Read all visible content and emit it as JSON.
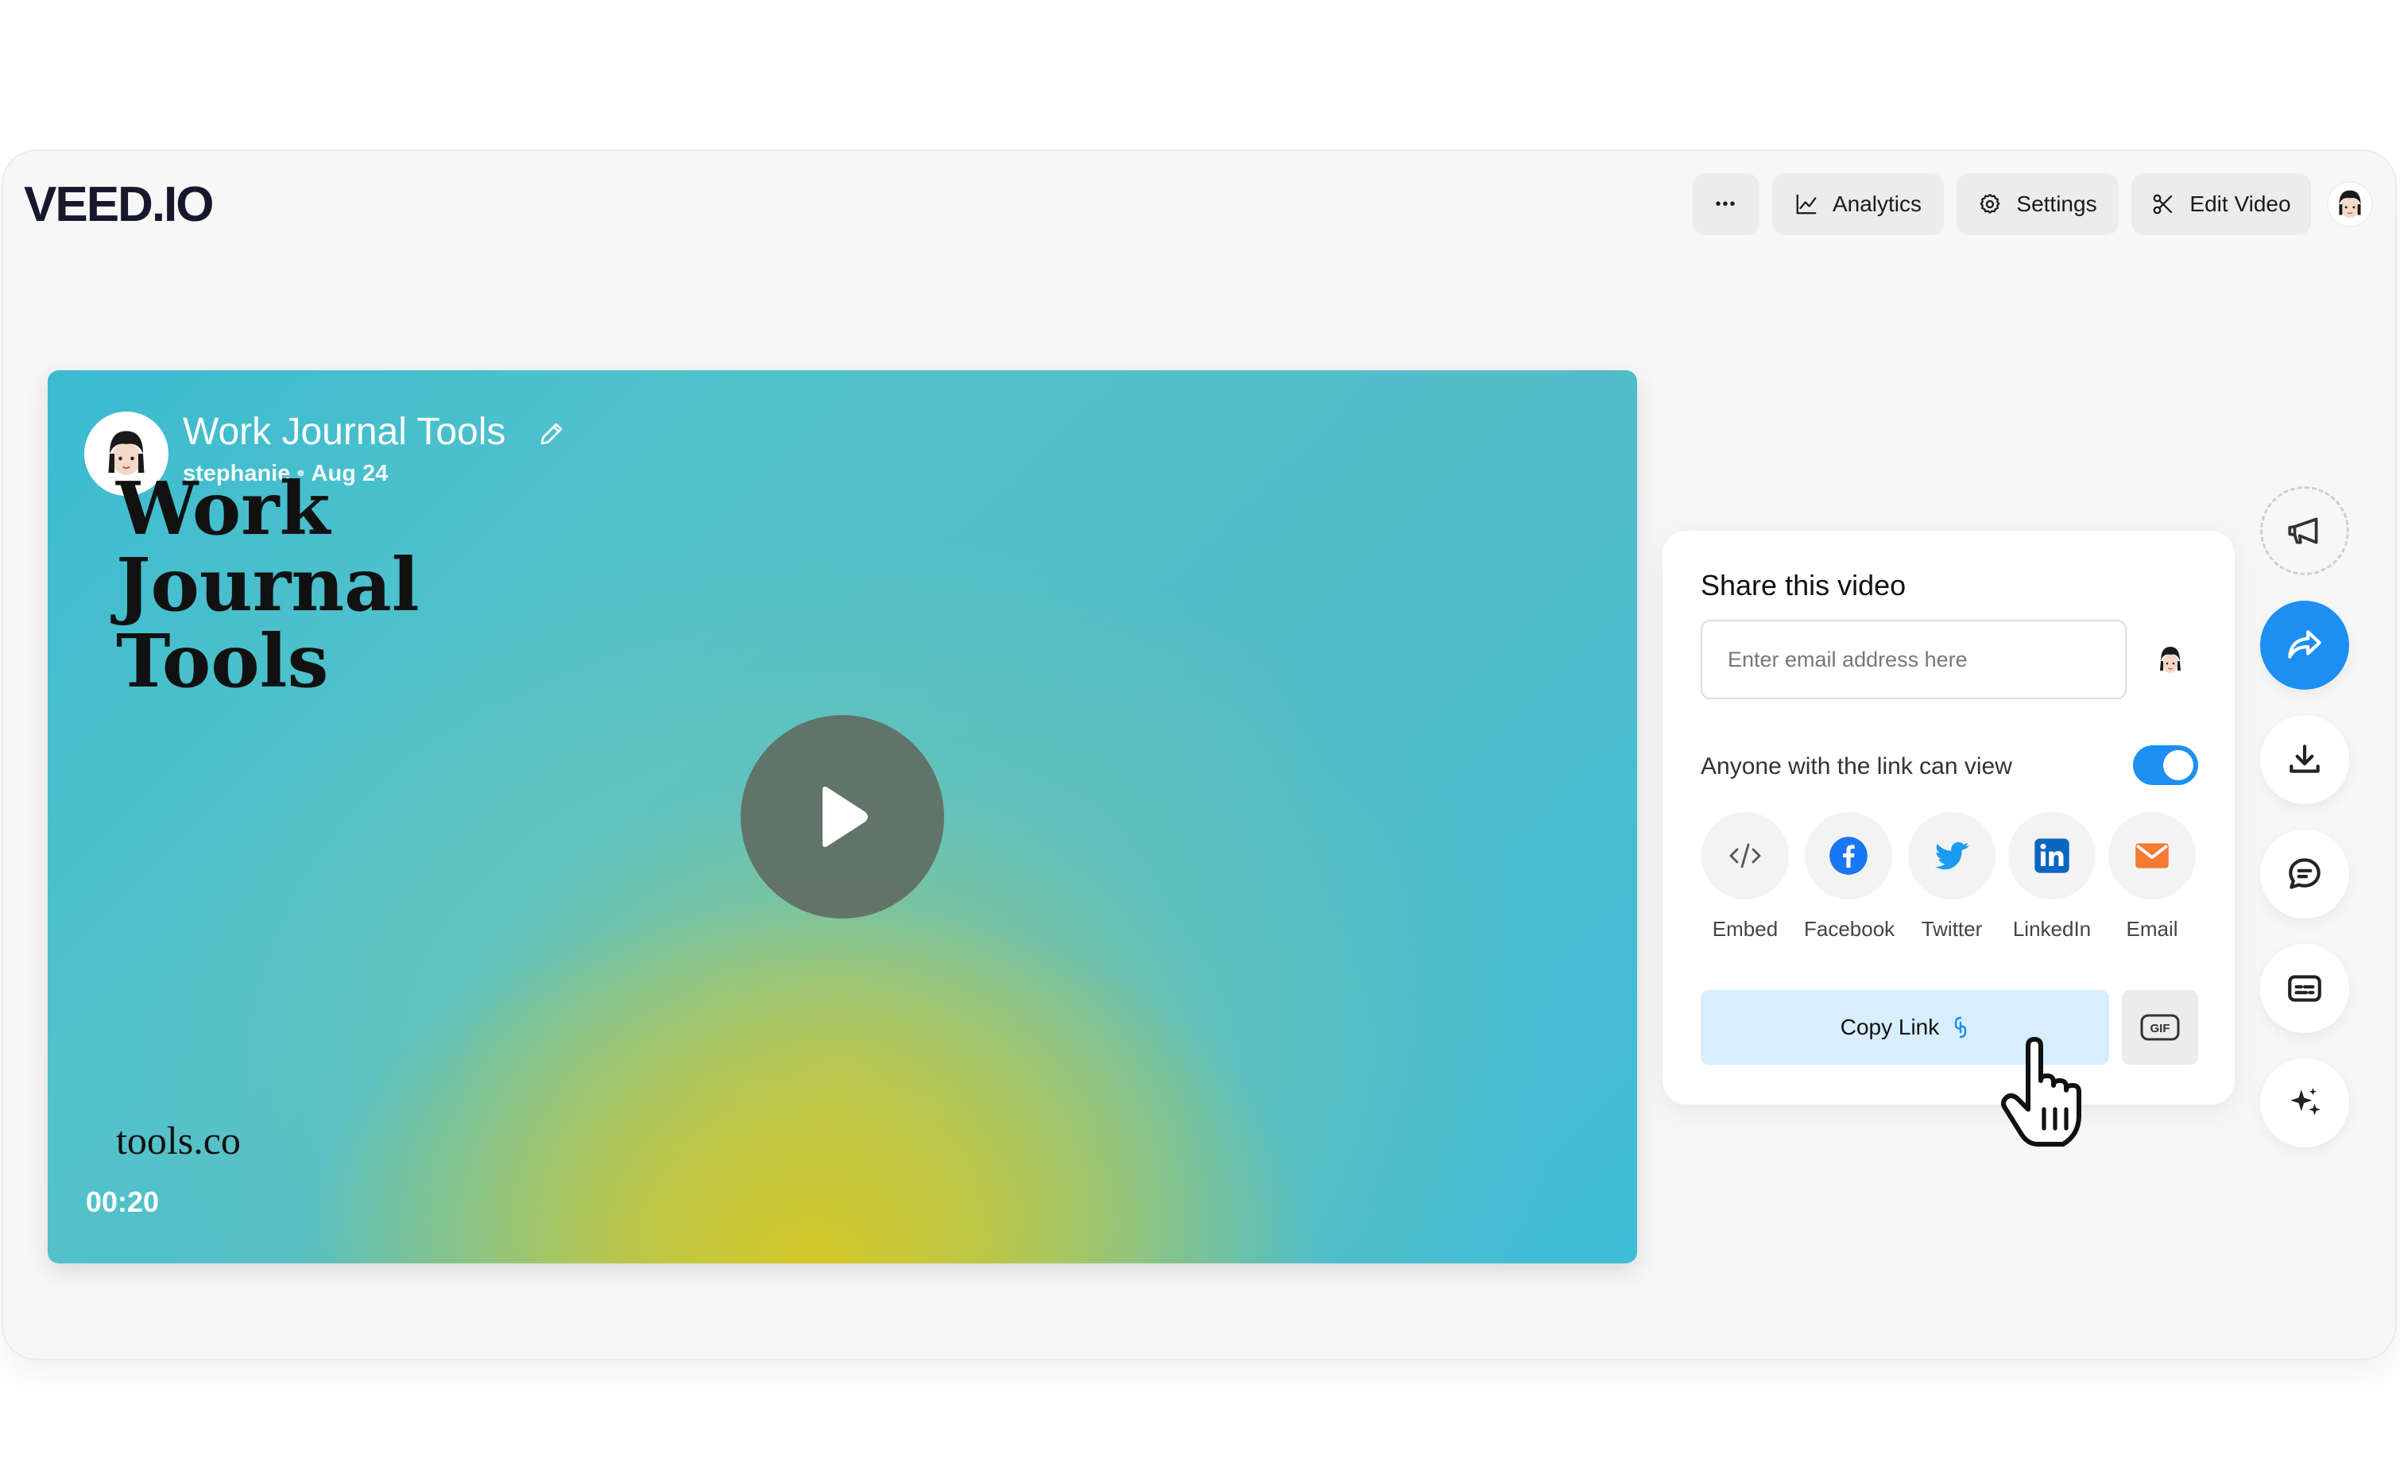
{
  "header": {
    "logo": "VEED.IO",
    "more_label": "•••",
    "analytics_label": "Analytics",
    "settings_label": "Settings",
    "edit_label": "Edit Video"
  },
  "video": {
    "title": "Work Journal Tools",
    "author": "stephanie",
    "separator": "•",
    "date": "Aug 24",
    "overlay_title": "Work\nJournal\nTools",
    "overlay_brand": "tools.co",
    "timecode": "00:20"
  },
  "share": {
    "title": "Share this video",
    "email_placeholder": "Enter email address here",
    "permission_label": "Anyone with the link can view",
    "permission_enabled": true,
    "options": [
      "Embed",
      "Facebook",
      "Twitter",
      "LinkedIn",
      "Email"
    ],
    "copy_link_label": "Copy Link",
    "gif_label": "GIF"
  },
  "colors": {
    "accent": "#1d8ff3",
    "copy_link_bg": "#d7eefe",
    "facebook": "#1877f2",
    "twitter": "#1d9bf0",
    "linkedin": "#0a66c2",
    "email": "#f47b33"
  },
  "icons": {
    "side_actions": [
      "megaphone-icon",
      "share-icon",
      "download-icon",
      "comment-icon",
      "captions-icon",
      "sparkle-icon"
    ]
  }
}
